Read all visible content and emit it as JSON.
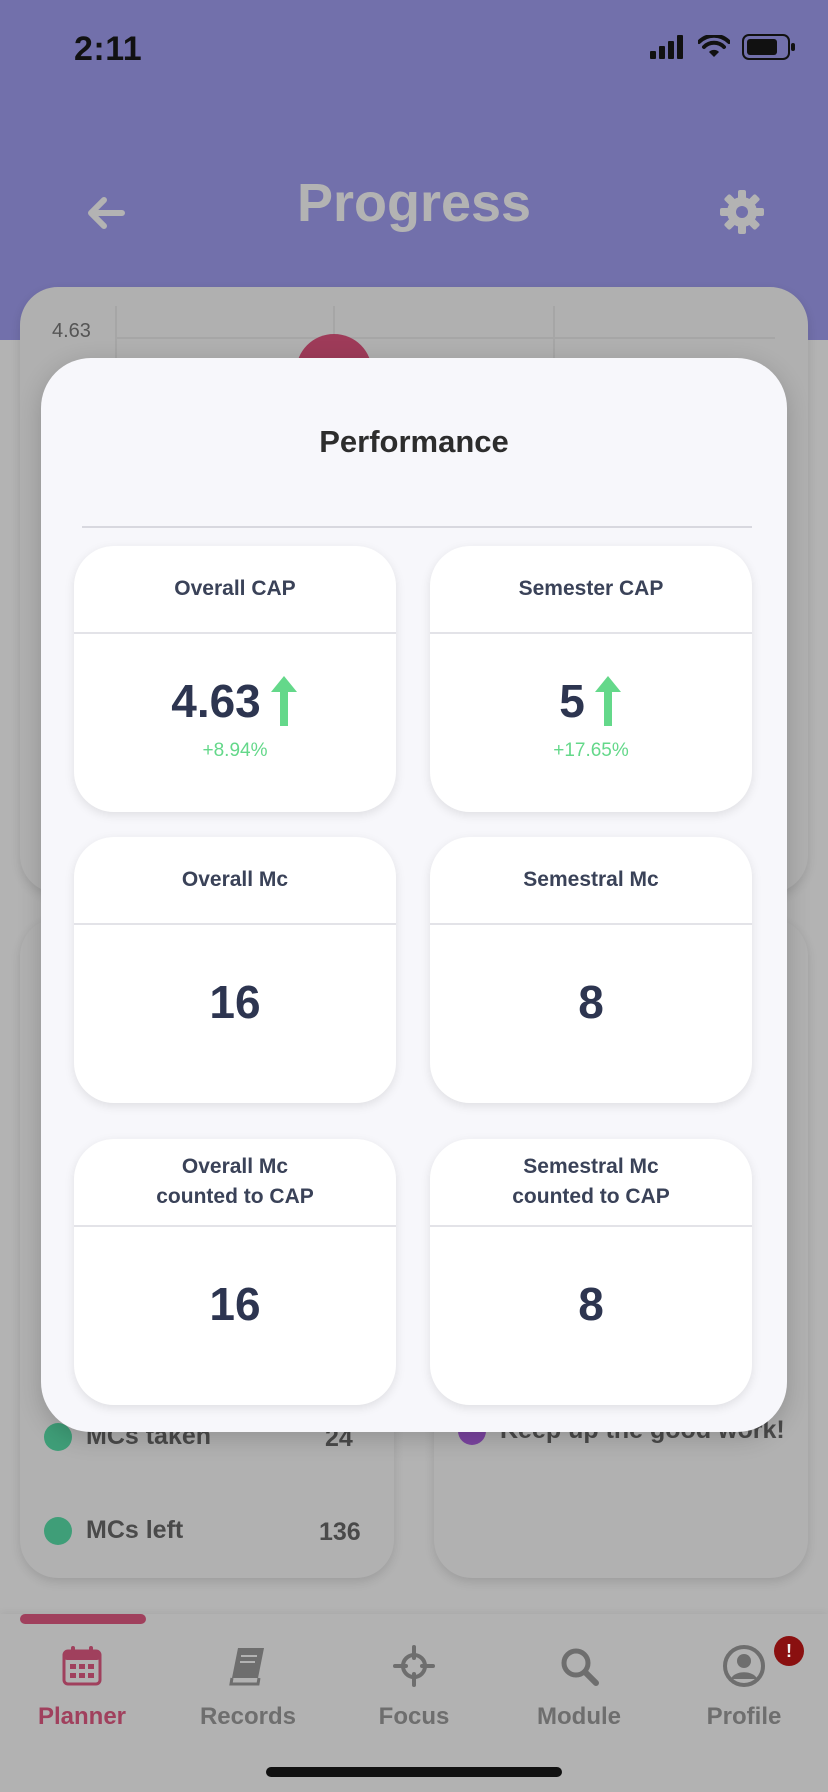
{
  "status_bar": {
    "time": "2:11"
  },
  "header": {
    "title": "Progress"
  },
  "chart": {
    "y_label": "4.63"
  },
  "background_cards": {
    "left": {
      "rows": [
        {
          "label": "MCs taken",
          "value": "24",
          "color": "#3f9e78"
        },
        {
          "label": "MCs left",
          "value": "136",
          "color": "#3f9e78"
        }
      ]
    },
    "right": {
      "message": "Keep up the good work!",
      "dot_color": "#7b44a0"
    }
  },
  "modal": {
    "title": "Performance",
    "cards": [
      {
        "label": "Overall CAP",
        "value": "4.63",
        "trend": "up",
        "change": "+8.94%"
      },
      {
        "label": "Semester CAP",
        "value": "5",
        "trend": "up",
        "change": "+17.65%"
      },
      {
        "label": "Overall Mc",
        "value": "16"
      },
      {
        "label": "Semestral Mc",
        "value": "8"
      },
      {
        "label": "Overall Mc\ncounted to CAP",
        "value": "16"
      },
      {
        "label": "Semestral Mc\ncounted to CAP",
        "value": "8"
      }
    ]
  },
  "nav": {
    "items": [
      {
        "label": "Planner",
        "icon": "calendar-icon",
        "active": true
      },
      {
        "label": "Records",
        "icon": "book-icon",
        "active": false
      },
      {
        "label": "Focus",
        "icon": "crosshair-icon",
        "active": false
      },
      {
        "label": "Module",
        "icon": "search-icon",
        "active": false
      },
      {
        "label": "Profile",
        "icon": "user-icon",
        "active": false
      }
    ],
    "badge": "!"
  },
  "colors": {
    "header": "#7270ab",
    "accent": "#a0405d",
    "positive": "#64d88a",
    "text_dark": "#2d3550"
  }
}
